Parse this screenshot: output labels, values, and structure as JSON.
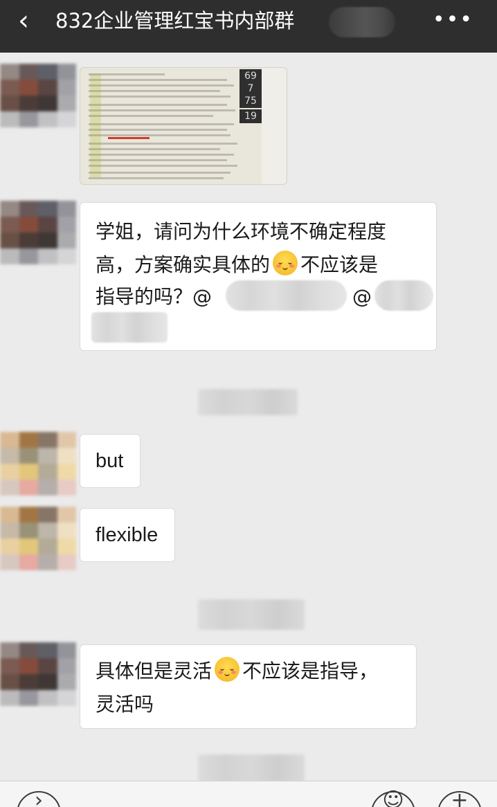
{
  "header": {
    "title": "832企业管理红宝书内部群",
    "back_icon": "‹",
    "more_icon": "•••"
  },
  "messages": {
    "m2": {
      "line1": "学姐，请问为什么环境不确定程度",
      "line2a": "高，方案确实具体的",
      "line2b": "不应该是",
      "line3": "指导的吗？@",
      "at2": "@"
    },
    "m3": {
      "text": "but"
    },
    "m4": {
      "text": "flexible"
    },
    "m5": {
      "line1a": "具体但是灵活",
      "line1b": "不应该是指导，",
      "line2": "灵活吗"
    }
  },
  "photo": {
    "heading": "CONTINGENCY FACTORS IN PLANNING",
    "page_numbers": [
      "69",
      "7",
      "75",
      "19"
    ]
  },
  "icons": {
    "back": "chevron-left-icon",
    "more": "more-dots-icon",
    "emoji": "blush-smile-emoji-icon",
    "voice": "voice-icon",
    "emoji_picker": "emoji-picker-icon",
    "add": "plus-icon"
  },
  "bottom": {
    "voice_glyph": "›",
    "emoji_glyph": "☺",
    "add_glyph": "+"
  }
}
